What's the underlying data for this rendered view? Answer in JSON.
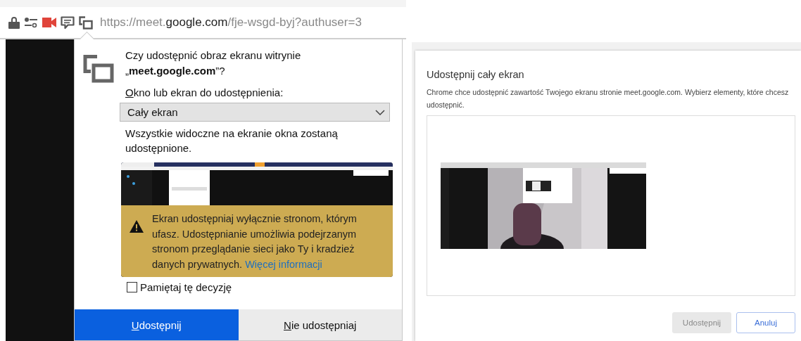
{
  "address_bar": {
    "url_parts": [
      {
        "text": "https://meet.",
        "emphasis": false
      },
      {
        "text": "google.com",
        "emphasis": true
      },
      {
        "text": "/fje-wsgd-byj?authuser=3",
        "emphasis": false
      }
    ],
    "camera_active": true
  },
  "firefox_prompt": {
    "title": "Czy udostępnić obraz ekranu witrynie „**meet.google.com**”?",
    "select_label": [
      {
        "text": "O",
        "underlined": true
      },
      {
        "text": "kno lub ekran do udostępnienia:",
        "underlined": false
      }
    ],
    "select": {
      "value": "Cały ekran"
    },
    "hint": "Wszystkie widoczne na ekranie okna zostaną udostępnione.",
    "warning": {
      "text": "Ekran udostępniaj wyłącznie stronom, którym ufasz. Udostępnianie umożliwia podejrzanym stronom przeglądanie sieci jako Ty i kradzież danych prywatnych.",
      "link": "Więcej informacji"
    },
    "remember": {
      "label": "Pamiętaj tę decyzję",
      "checked": false
    },
    "buttons": [
      {
        "label": [
          {
            "text": "U",
            "underlined": true
          },
          {
            "text": "dostępnij",
            "underlined": false
          }
        ],
        "kind": "primary"
      },
      {
        "label": [
          {
            "text": "N",
            "underlined": true
          },
          {
            "text": "ie udostępniaj",
            "underlined": false
          }
        ],
        "kind": "secondary"
      }
    ]
  },
  "chrome_dialog": {
    "title": "Udostępnij cały ekran",
    "description": "Chrome chce udostępnić zawartość Twojego ekranu stronie meet.google.com. Wybierz elementy, które chcesz udostępnić.",
    "buttons": [
      {
        "label": "Udostępnij",
        "kind": "primary",
        "disabled": true
      },
      {
        "label": "Anuluj",
        "kind": "secondary",
        "disabled": false
      }
    ]
  }
}
